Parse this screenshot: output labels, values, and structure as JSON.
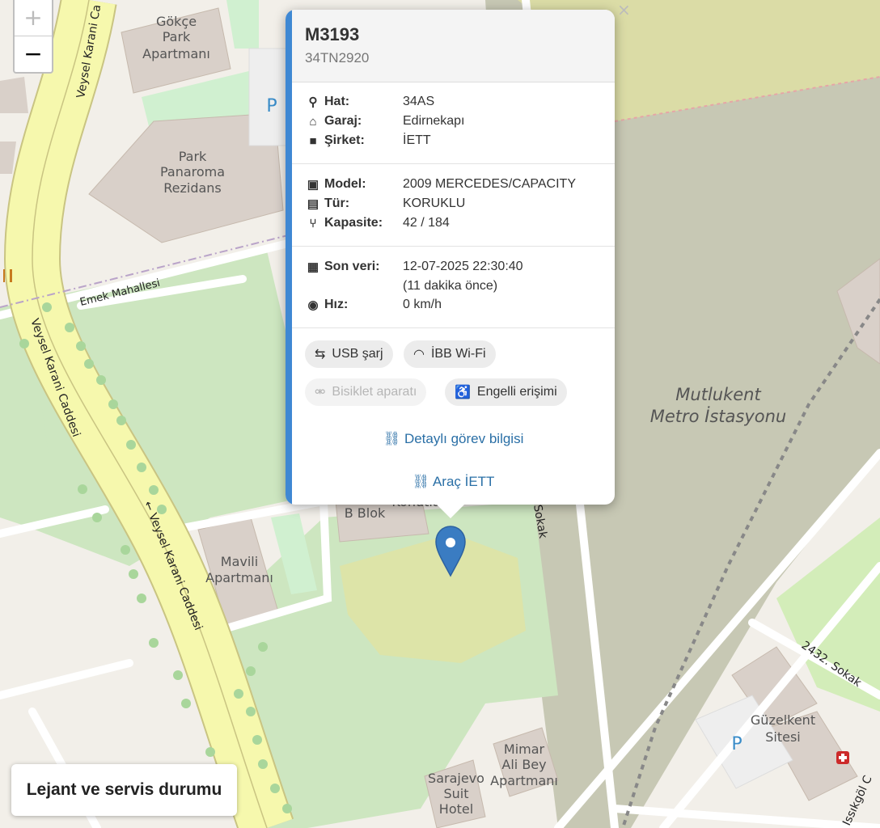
{
  "zoom": {
    "in_label": "+",
    "out_label": "−"
  },
  "map": {
    "labels": {
      "gokce1": "Gökçe",
      "gokce2": "Park",
      "gokce3": "Apartmanı",
      "pano1": "Park",
      "pano2": "Panaroma",
      "pano3": "Rezidans",
      "mavili1": "Mavili",
      "mavili2": "Apartmanı",
      "bblok": "B Blok",
      "konutlari": "Konutları",
      "mutlu1": "Mutlukent",
      "mutlu2": "Metro İstasyonu",
      "guzel1": "Güzelkent",
      "guzel2": "Sitesi",
      "mimar1": "Mimar",
      "mimar2": "Ali Bey",
      "mimar3": "Apartmanı",
      "sara1": "Sarajevo",
      "sara2": "Suit",
      "sara3": "Hotel",
      "veysel_top": "Veysel Karani Ca",
      "veysel_mid": "Veysel Karani Caddesi",
      "veysel_low": "← Veysel Karani Caddesi",
      "emek": "Emek Mahallesi",
      "sokak2432": "2432. Sokak",
      "sokak_mid": "Sokak",
      "issikgol": "Issıkgöl C",
      "parking": "P"
    }
  },
  "popup": {
    "title": "M3193",
    "plate": "34TN2920",
    "hat_label": "Hat:",
    "hat_value": "34AS",
    "garaj_label": "Garaj:",
    "garaj_value": "Edirnekapı",
    "sirket_label": "Şirket:",
    "sirket_value": "İETT",
    "model_label": "Model:",
    "model_value": "2009 MERCEDES/CAPACITY",
    "tur_label": "Tür:",
    "tur_value": "KORUKLU",
    "kapasite_label": "Kapasite:",
    "kapasite_value": "42 / 184",
    "sonveri_label": "Son veri:",
    "sonveri_value": "12-07-2025 22:30:40",
    "sonveri_ago": "(11 dakika önce)",
    "hiz_label": "Hız:",
    "hiz_value": "0 km/h",
    "features": {
      "usb": "USB şarj",
      "wifi": "İBB Wi-Fi",
      "bike": "Bisiklet aparatı",
      "access": "Engelli erişimi"
    },
    "link_detail": "Detaylı görev bilgisi",
    "link_vehicle": "Araç İETT",
    "close": "×"
  },
  "legend": {
    "label": "Lejant ve servis durumu"
  },
  "colors": {
    "accent": "#3f88d3",
    "marker": "#3a7cc2",
    "link": "#2a6fa6"
  }
}
